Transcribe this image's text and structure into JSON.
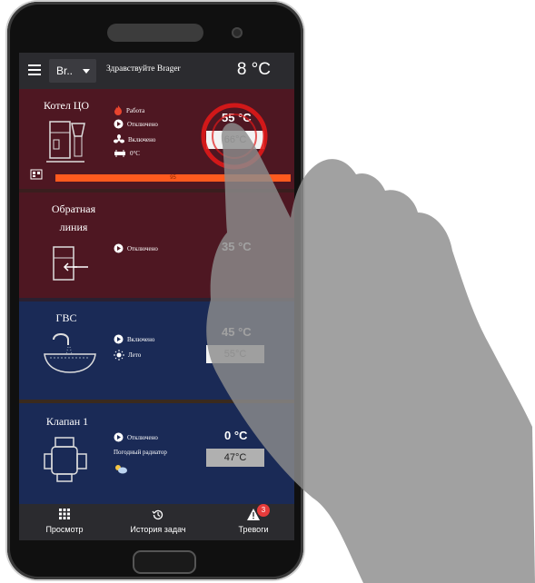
{
  "header": {
    "user_select": "Br..",
    "greeting": "Здравствуйте Brager",
    "outside_temp": "8 °C"
  },
  "cards": {
    "boiler": {
      "title": "Котел ЦО",
      "status": [
        "Работа",
        "Отключено",
        "Включено",
        "0°C"
      ],
      "temp": "55 °C",
      "setpoint": "66°C",
      "progress_value": 95,
      "progress_label": "95"
    },
    "return": {
      "title_line1": "Обратная",
      "title_line2": "линия",
      "status": [
        "Отключено"
      ],
      "temp": "35 °C"
    },
    "dhw": {
      "title": "ГВС",
      "status": [
        "Включено",
        "Лето"
      ],
      "temp": "45 °C",
      "setpoint": "55°C"
    },
    "valve": {
      "title": "Клапан 1",
      "status": [
        "Отключено",
        "Погодный радиатор"
      ],
      "temp": "0 °C",
      "setpoint": "47°C"
    }
  },
  "nav": {
    "overview": "Просмотр",
    "history": "История задач",
    "alarms": "Тревоги",
    "alarms_badge": "3"
  },
  "colors": {
    "red_card": "#4e1722",
    "blue_card": "#1a2a56",
    "accent": "#ff5a1e"
  }
}
